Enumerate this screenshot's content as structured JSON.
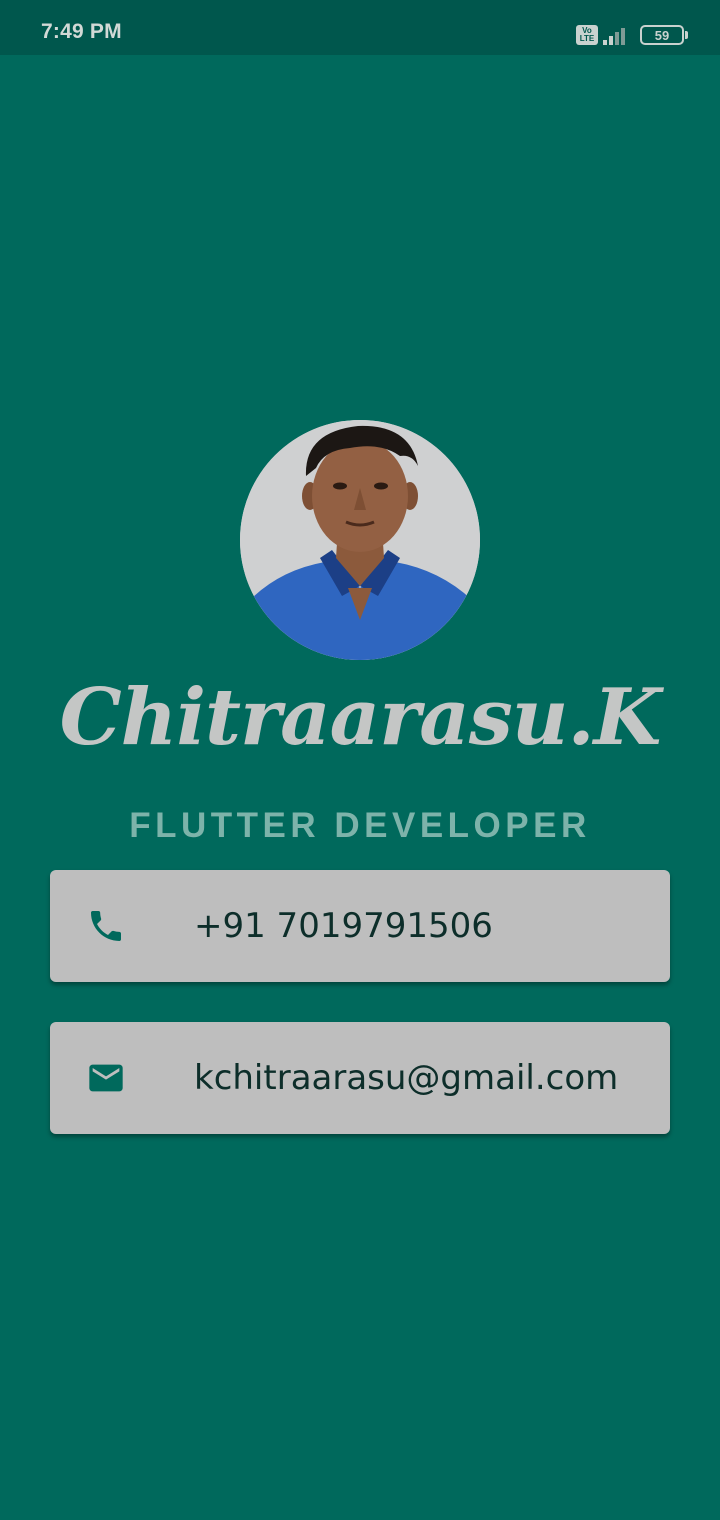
{
  "status_bar": {
    "time": "7:49 PM",
    "volte_label_top": "Vo",
    "volte_label_bottom": "LTE",
    "battery_level": "59",
    "signal_icon": "signal-icon",
    "battery_icon": "battery-icon"
  },
  "profile": {
    "name": "Chitraarasu.K",
    "role": "FLUTTER DEVELOPER"
  },
  "contacts": [
    {
      "icon": "phone-icon",
      "value": "+91 7019791506"
    },
    {
      "icon": "mail-icon",
      "value": "kchitraarasu@gmail.com"
    }
  ],
  "colors": {
    "background": "#00695c",
    "status_bar": "#00574d",
    "card": "#bebebe",
    "icon": "#00695c",
    "name_text": "#c4c6c5",
    "role_text": "#7db3aa"
  }
}
